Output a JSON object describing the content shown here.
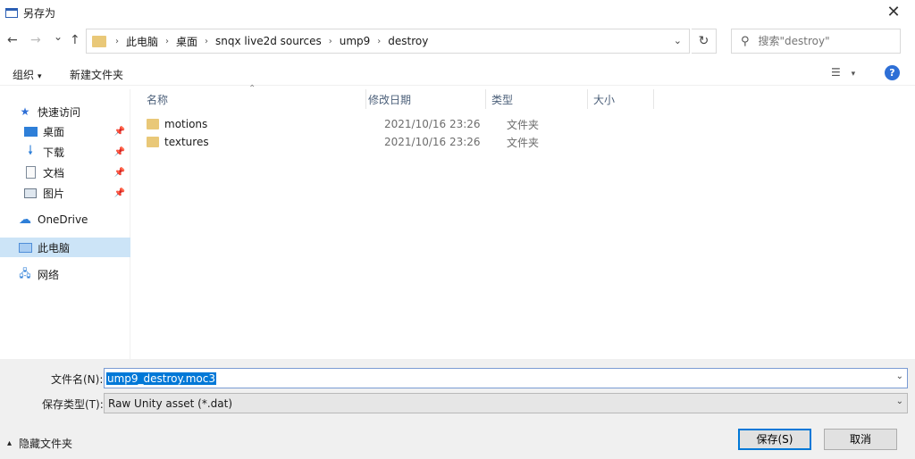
{
  "window": {
    "title": "另存为",
    "close": "✕"
  },
  "nav": {
    "back": "←",
    "forward": "→",
    "history": "⌄",
    "up": "↑",
    "breadcrumb": [
      "此电脑",
      "桌面",
      "snqx live2d sources",
      "ump9",
      "destroy"
    ],
    "breadcrumb_sep": "›",
    "addr_dropdown": "⌄",
    "refresh": "↻",
    "search_placeholder": "搜索\"destroy\""
  },
  "toolbar": {
    "organize": "组织",
    "organize_caret": "▾",
    "new_folder": "新建文件夹",
    "view_caret": "▾",
    "help": "?"
  },
  "sidebar": {
    "quick_access": "快速访问",
    "items": [
      {
        "label": "桌面",
        "pinned": true
      },
      {
        "label": "下载",
        "pinned": true
      },
      {
        "label": "文档",
        "pinned": true
      },
      {
        "label": "图片",
        "pinned": true
      }
    ],
    "onedrive": "OneDrive",
    "this_pc": "此电脑",
    "network": "网络"
  },
  "columns": {
    "name": "名称",
    "modified": "修改日期",
    "type": "类型",
    "size": "大小"
  },
  "files": [
    {
      "name": "motions",
      "modified": "2021/10/16 23:26",
      "type": "文件夹"
    },
    {
      "name": "textures",
      "modified": "2021/10/16 23:26",
      "type": "文件夹"
    }
  ],
  "footer": {
    "filename_label": "文件名(N):",
    "filename_value": "ump9_destroy.moc3",
    "filetype_label": "保存类型(T):",
    "filetype_value": "Raw Unity asset (*.dat)",
    "dropdown": "⌄",
    "hide_folders": "隐藏文件夹",
    "hide_chevron": "▴",
    "save": "保存(S)",
    "cancel": "取消"
  },
  "colors": {
    "accent": "#0078d7",
    "folder": "#e9c878",
    "selected_bg": "#cce4f7"
  }
}
